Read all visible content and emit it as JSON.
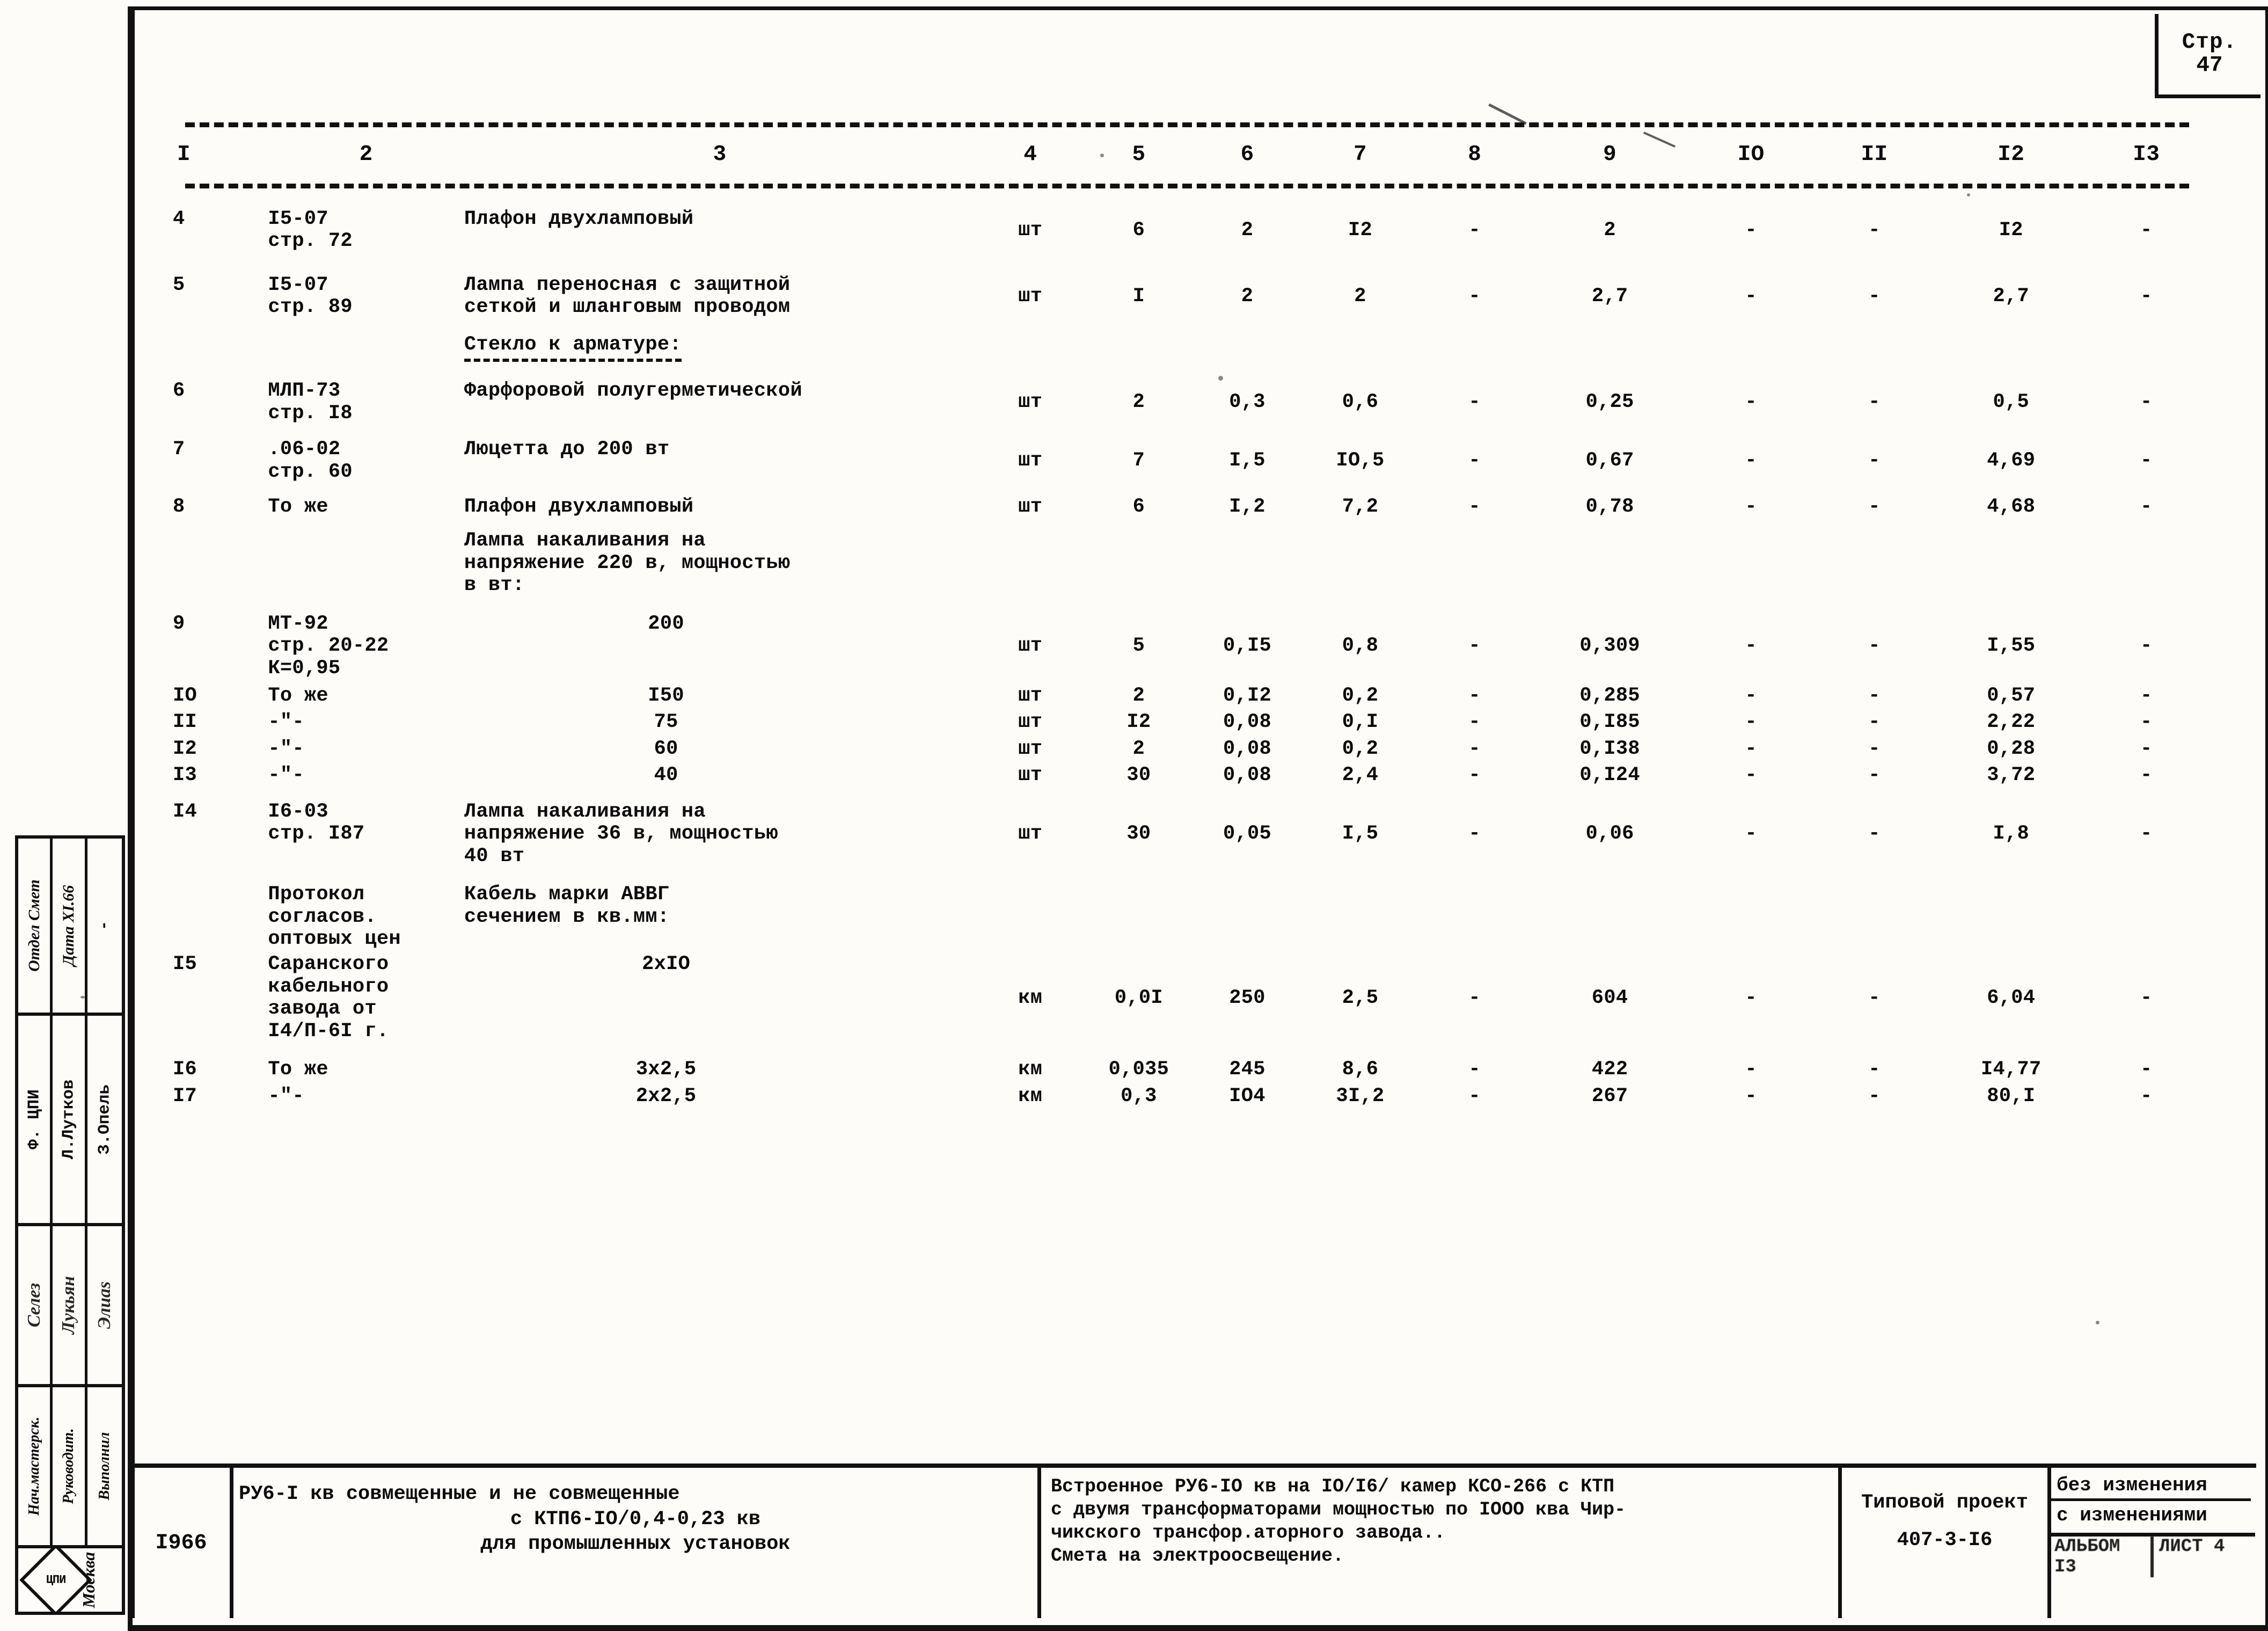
{
  "page": {
    "label": "Стр.",
    "number": "47"
  },
  "table": {
    "headers": [
      "I",
      "2",
      "3",
      "4",
      "5",
      "6",
      "7",
      "8",
      "9",
      "IO",
      "II",
      "I2",
      "I3"
    ],
    "rows": [
      {
        "n": "4",
        "ref": "I5-07\nстр. 72",
        "name": "Плафон двухламповый",
        "unit": "шт",
        "c5": "6",
        "c6": "2",
        "c7": "I2",
        "c8": "-",
        "c9": "2",
        "c10": "-",
        "c11": "-",
        "c12": "I2",
        "c13": "-"
      },
      {
        "n": "5",
        "ref": "I5-07\nстр. 89",
        "name": "Лампа переносная с защитной\nсеткой и шланговым проводом",
        "unit": "шт",
        "c5": "I",
        "c6": "2",
        "c7": "2",
        "c8": "-",
        "c9": "2,7",
        "c10": "-",
        "c11": "-",
        "c12": "2,7",
        "c13": "-"
      },
      {
        "n": "",
        "ref": "",
        "name": "Стекло к арматуре:",
        "subhead": true,
        "unit": "",
        "c5": "",
        "c6": "",
        "c7": "",
        "c8": "",
        "c9": "",
        "c10": "",
        "c11": "",
        "c12": "",
        "c13": ""
      },
      {
        "n": "6",
        "ref": "МЛП-73\nстр. I8",
        "name": "Фарфоровой полугерметической",
        "unit": "шт",
        "c5": "2",
        "c6": "0,3",
        "c7": "0,6",
        "c8": "-",
        "c9": "0,25",
        "c10": "-",
        "c11": "-",
        "c12": "0,5",
        "c13": "-"
      },
      {
        "n": "7",
        "ref": ".06-02\nстр. 60",
        "name": "Люцетта до 200 вт",
        "unit": "шт",
        "c5": "7",
        "c6": "I,5",
        "c7": "IO,5",
        "c8": "-",
        "c9": "0,67",
        "c10": "-",
        "c11": "-",
        "c12": "4,69",
        "c13": "-"
      },
      {
        "n": "8",
        "ref": "То же",
        "name": "Плафон двухламповый",
        "unit": "шт",
        "c5": "6",
        "c6": "I,2",
        "c7": "7,2",
        "c8": "-",
        "c9": "0,78",
        "c10": "-",
        "c11": "-",
        "c12": "4,68",
        "c13": "-"
      },
      {
        "n": "",
        "ref": "",
        "name": "Лампа накаливания на\nнапряжение 220 в, мощностью\nв вт:",
        "unit": "",
        "c5": "",
        "c6": "",
        "c7": "",
        "c8": "",
        "c9": "",
        "c10": "",
        "c11": "",
        "c12": "",
        "c13": ""
      },
      {
        "n": "9",
        "ref": "МТ-92\nстр. 20-22\nК=0,95",
        "name": "200",
        "center": true,
        "unit": "шт",
        "c5": "5",
        "c6": "0,I5",
        "c7": "0,8",
        "c8": "-",
        "c9": "0,309",
        "c10": "-",
        "c11": "-",
        "c12": "I,55",
        "c13": "-"
      },
      {
        "n": "IO",
        "ref": "То же",
        "name": "I50",
        "center": true,
        "unit": "шт",
        "c5": "2",
        "c6": "0,I2",
        "c7": "0,2",
        "c8": "-",
        "c9": "0,285",
        "c10": "-",
        "c11": "-",
        "c12": "0,57",
        "c13": "-"
      },
      {
        "n": "II",
        "ref": "-\"-",
        "name": "75",
        "center": true,
        "unit": "шт",
        "c5": "I2",
        "c6": "0,08",
        "c7": "0,I",
        "c8": "-",
        "c9": "0,I85",
        "c10": "-",
        "c11": "-",
        "c12": "2,22",
        "c13": "-"
      },
      {
        "n": "I2",
        "ref": "-\"-",
        "name": "60",
        "center": true,
        "unit": "шт",
        "c5": "2",
        "c6": "0,08",
        "c7": "0,2",
        "c8": "-",
        "c9": "0,I38",
        "c10": "-",
        "c11": "-",
        "c12": "0,28",
        "c13": "-"
      },
      {
        "n": "I3",
        "ref": "-\"-",
        "name": "40",
        "center": true,
        "unit": "шт",
        "c5": "30",
        "c6": "0,08",
        "c7": "2,4",
        "c8": "-",
        "c9": "0,I24",
        "c10": "-",
        "c11": "-",
        "c12": "3,72",
        "c13": "-"
      },
      {
        "n": "I4",
        "ref": "I6-03\nстр. I87",
        "name": "Лампа накаливания на\nнапряжение 36 в, мощностью\n40 вт",
        "unit": "шт",
        "c5": "30",
        "c6": "0,05",
        "c7": "I,5",
        "c8": "-",
        "c9": "0,06",
        "c10": "-",
        "c11": "-",
        "c12": "I,8",
        "c13": "-"
      },
      {
        "n": "",
        "ref": "Протокол\nсогласов.\nоптовых цен",
        "name": "Кабель марки АВВГ\nсечением в кв.мм:",
        "unit": "",
        "c5": "",
        "c6": "",
        "c7": "",
        "c8": "",
        "c9": "",
        "c10": "",
        "c11": "",
        "c12": "",
        "c13": ""
      },
      {
        "n": "I5",
        "ref": "Саранского\nкабельного\nзавода от\nI4/П-6I г.",
        "name": "2хIO",
        "center": true,
        "unit": "км",
        "c5": "0,0I",
        "c6": "250",
        "c7": "2,5",
        "c8": "-",
        "c9": "604",
        "c10": "-",
        "c11": "-",
        "c12": "6,04",
        "c13": "-"
      },
      {
        "n": "I6",
        "ref": "То же",
        "name": "3х2,5",
        "center": true,
        "unit": "км",
        "c5": "0,035",
        "c6": "245",
        "c7": "8,6",
        "c8": "-",
        "c9": "422",
        "c10": "-",
        "c11": "-",
        "c12": "I4,77",
        "c13": "-"
      },
      {
        "n": "I7",
        "ref": "-\"-",
        "name": "2х2,5",
        "center": true,
        "unit": "км",
        "c5": "0,3",
        "c6": "IO4",
        "c7": "3I,2",
        "c8": "-",
        "c9": "267",
        "c10": "-",
        "c11": "-",
        "c12": "80,I",
        "c13": "-"
      }
    ]
  },
  "title_block": {
    "year": "I966",
    "title_lines": [
      "РУ6-I кв совмещенные и не совмещенные",
      "с КТП6-IO/0,4-0,23 кв",
      "для промышленных установок"
    ],
    "object": "Встроенное РУ6-IO кв на IO/I6/ камер КСО-266 с КТП\nс двумя трансформаторами мощностью по IOOO ква Чир-\nчикского трансфор.аторного завода..\nСмета на электроосвещение.",
    "project_label": "Типовой проект",
    "project_code": "407-3-I6",
    "changes_without": "без изменения",
    "changes_with": "с изменениями",
    "stamp_left": "АЛЬБОМ I3",
    "stamp_right": "ЛИСТ 4"
  },
  "side_stamp": {
    "row_a": [
      "Отдел Смет",
      "Дата XI.66",
      "-"
    ],
    "row_b": [
      "Ф. ЦПИ",
      "Л.Лутков",
      "З.Опель"
    ],
    "row_c": [
      "Селез",
      "Лукьян",
      "Элиаs"
    ],
    "row_d": [
      "Нач.мастерск.",
      "Руководит.",
      "Выполнил"
    ],
    "logo_text": "ЦПИ",
    "city": "Москва"
  }
}
